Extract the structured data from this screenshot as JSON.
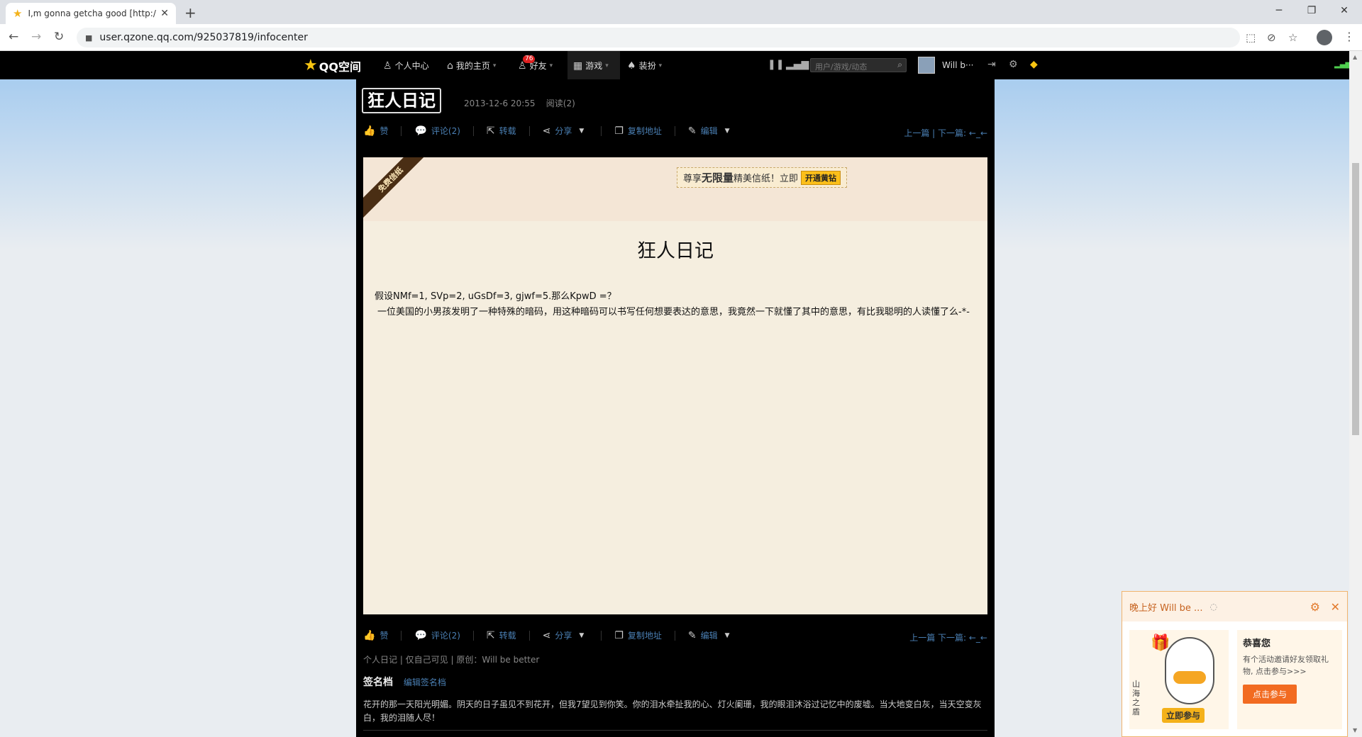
{
  "browser": {
    "tab_title": "I,m gonna getcha good [http://",
    "url": "user.qzone.qq.com/925037819/infocenter",
    "new_tab": "+",
    "minimize": "─",
    "restore": "❐",
    "close": "✕"
  },
  "qzone_nav": {
    "logo": "QQ空间",
    "items": [
      "个人中心",
      "我的主页",
      "好友",
      "游戏",
      "装扮"
    ],
    "friends_badge": "76",
    "search_placeholder": "用户/游戏/动态",
    "username": "Will b···"
  },
  "diary": {
    "title": "狂人日记",
    "date": "2013-12-6 20:55",
    "reads": "阅读(2)",
    "actions": {
      "like": "赞",
      "comment": "评论(2)",
      "repost": "转载",
      "share": "分享",
      "copy_link": "复制地址",
      "edit": "编辑"
    },
    "prev_next_top": "上一篇 | 下一篇: ←_←",
    "prev_next_bottom": "上一篇 下一篇: ←_←"
  },
  "paper": {
    "ribbon": "免费信纸",
    "promo_pre": "尊享",
    "promo_bold": "无限量",
    "promo_post": "精美信纸！立即",
    "promo_button": "开通黄钻",
    "title": "狂人日记",
    "line1": "假设NMf=1, SVp=2, uGsDf=3, gjwf=5.那么KpwD =？",
    "line2": "一位美国的小男孩发明了一种特殊的暗码，用这种暗码可以书写任何想要表达的意思，我竟然一下就懂了其中的意思，有比我聪明的人读懂了么-*-"
  },
  "footer": {
    "meta": "个人日记 | 仅自己可见 | 原创：Will be better",
    "signature_heading": "签名档",
    "edit_signature": "编辑签名档",
    "signature_text": "花开的那一天阳光明媚。阴天的日子虽见不到花开，但我7望见到你笑。你的泪水牵扯我的心、灯火阑珊，我的眼泪沐浴过记忆中的废墟。当大地变白灰，当天空变灰白，我的泪随人尽！"
  },
  "popup": {
    "greeting": "晚上好 Will be ...",
    "heading": "恭喜您",
    "text": "有个活动邀请好友领取礼物, 点击参与>>>",
    "button": "点击参与",
    "art_button": "立即参与",
    "art_side": "山海之盾"
  }
}
